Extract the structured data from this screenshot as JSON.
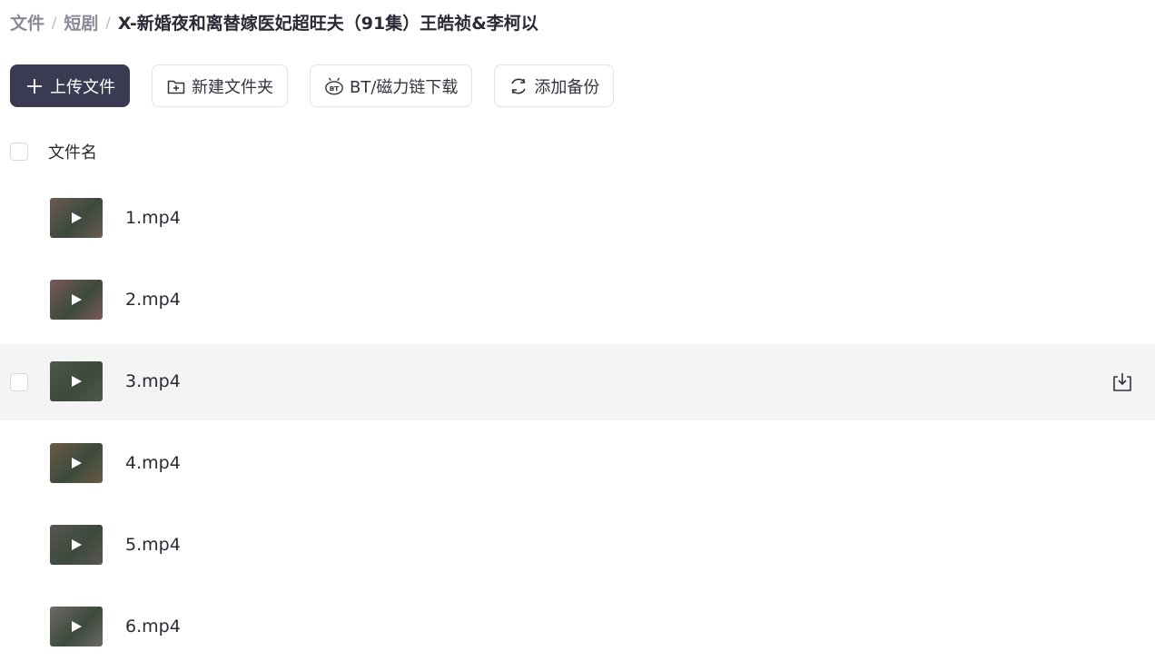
{
  "breadcrumb": {
    "items": [
      "文件",
      "短剧"
    ],
    "separator": "/",
    "current": "X-新婚夜和离替嫁医妃超旺夫（91集）王皓祯&李柯以"
  },
  "toolbar": {
    "upload": {
      "label": "上传文件",
      "icon": "plus-icon"
    },
    "new_folder": {
      "label": "新建文件夹",
      "icon": "folder-plus-icon"
    },
    "bt_download": {
      "label": "BT/磁力链下载",
      "icon": "bt-icon"
    },
    "add_backup": {
      "label": "添加备份",
      "icon": "sync-icon"
    }
  },
  "list": {
    "header_label": "文件名",
    "files": [
      {
        "name": "1.mp4",
        "thumb_color": "#6b5a52"
      },
      {
        "name": "2.mp4",
        "thumb_color": "#7a5a58"
      },
      {
        "name": "3.mp4",
        "thumb_color": "#4f5a48"
      },
      {
        "name": "4.mp4",
        "thumb_color": "#6a5a46"
      },
      {
        "name": "5.mp4",
        "thumb_color": "#5a5654"
      },
      {
        "name": "6.mp4",
        "thumb_color": "#6e6a68"
      }
    ],
    "hovered_index": 2,
    "hover_action_icon": "download-icon"
  },
  "colors": {
    "primary_button": "#3a3a52",
    "hover_row": "#f4f4f5"
  }
}
